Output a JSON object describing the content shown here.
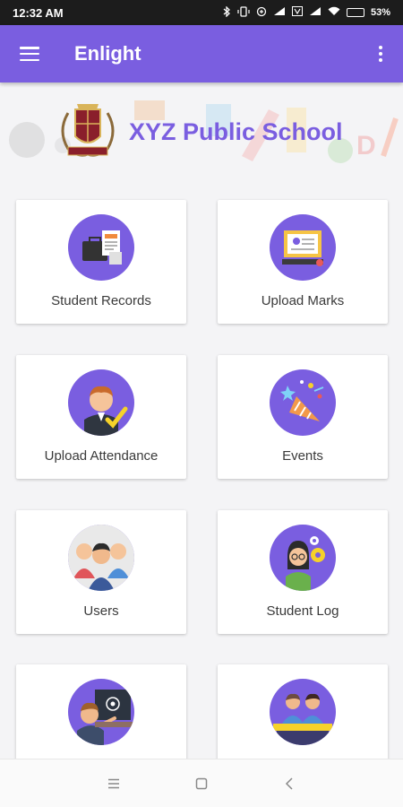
{
  "status_bar": {
    "time": "12:32 AM",
    "battery_percent": "53%",
    "battery_level": 0.53
  },
  "app_bar": {
    "title": "Enlight",
    "menu_icon": "hamburger-menu-icon",
    "more_icon": "more-vert-icon"
  },
  "banner": {
    "school_name": "XYZ Public School",
    "logo_icon": "school-crest-logo"
  },
  "cards": [
    {
      "label": "Student Records",
      "icon": "briefcase-records-icon"
    },
    {
      "label": "Upload Marks",
      "icon": "exam-sheet-icon"
    },
    {
      "label": "Upload Attendance",
      "icon": "student-check-icon"
    },
    {
      "label": "Events",
      "icon": "party-popper-icon"
    },
    {
      "label": "Users",
      "icon": "people-group-icon"
    },
    {
      "label": "Student Log",
      "icon": "girl-gears-icon"
    },
    {
      "label": "",
      "icon": "teacher-board-icon"
    },
    {
      "label": "",
      "icon": "students-desk-icon"
    }
  ],
  "nav_bar": {
    "recents_icon": "recents-icon",
    "home_icon": "home-square-icon",
    "back_icon": "back-chevron-icon"
  },
  "colors": {
    "accent": "#7a5ee0",
    "status_bar": "#1c1c1c",
    "background": "#f4f4f6"
  }
}
